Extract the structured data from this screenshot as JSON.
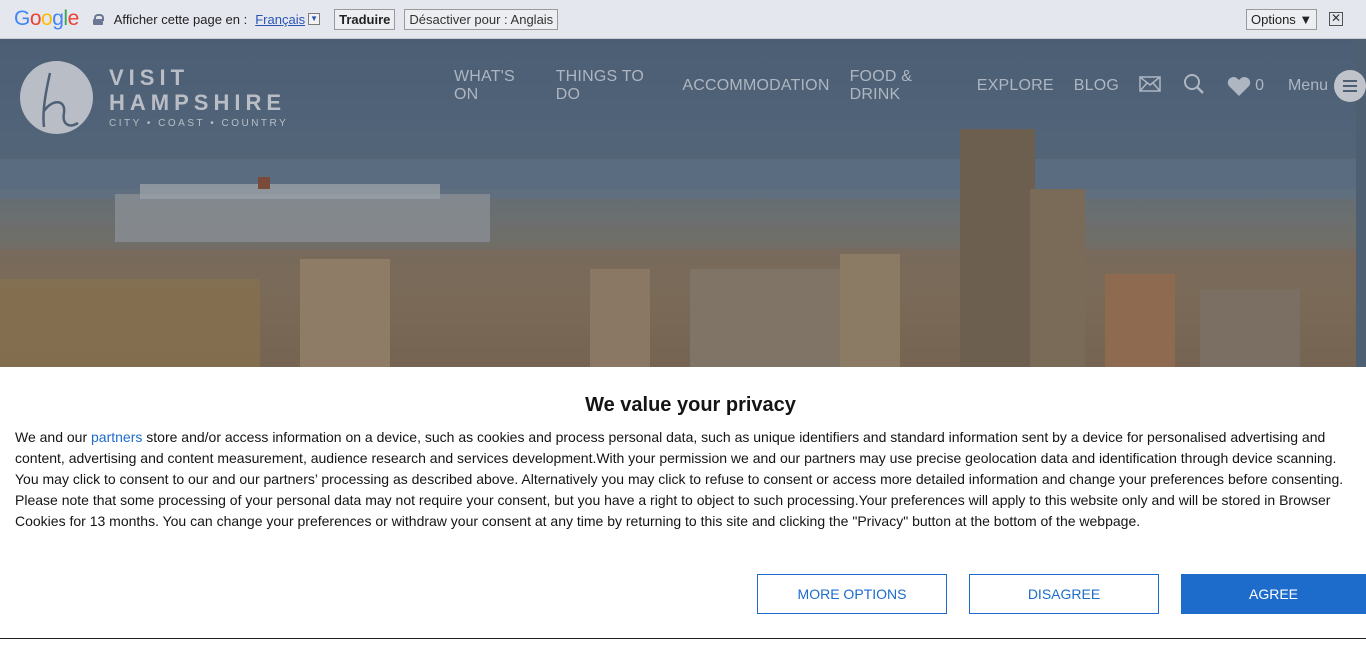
{
  "translate_bar": {
    "logo_text": "Google",
    "prompt": "Afficher cette page en :",
    "language": "Français",
    "translate_button": "Traduire",
    "disable_button": "Désactiver pour : Anglais",
    "options_button": "Options ▼",
    "close_glyph": "✕"
  },
  "site": {
    "logo": {
      "line1": "VISIT",
      "line2": "HAMPSHIRE",
      "tagline": "CITY • COAST • COUNTRY"
    },
    "nav": {
      "items": [
        "WHAT'S ON",
        "THINGS TO DO",
        "ACCOMMODATION",
        "FOOD & DRINK",
        "EXPLORE",
        "BLOG"
      ],
      "favorites_count": "0",
      "menu_label": "Menu"
    }
  },
  "privacy": {
    "title": "We value your privacy",
    "body_before_link": "We and our ",
    "link_text": "partners",
    "body_after_link": " store and/or access information on a device, such as cookies and process personal data, such as unique identifiers and standard information sent by a device for personalised advertising and content, advertising and content measurement, audience research and services development.With your permission we and our partners may use precise geolocation data and identification through device scanning. You may click to consent to our and our partners’ processing as described above. Alternatively you may click to refuse to consent or access more detailed information and change your preferences before consenting. Please note that some processing of your personal data may not require your consent, but you have a right to object to such processing.Your preferences will apply to this website only and will be stored in Browser Cookies for 13 months. You can change your preferences or withdraw your consent at any time by returning to this site and clicking the \"Privacy\" button at the bottom of the webpage.",
    "buttons": {
      "more_options": "MORE OPTIONS",
      "disagree": "DISAGREE",
      "agree": "AGREE"
    }
  },
  "colors": {
    "accent": "#1d6ccc",
    "hero_overlay": "#4a5c72"
  }
}
